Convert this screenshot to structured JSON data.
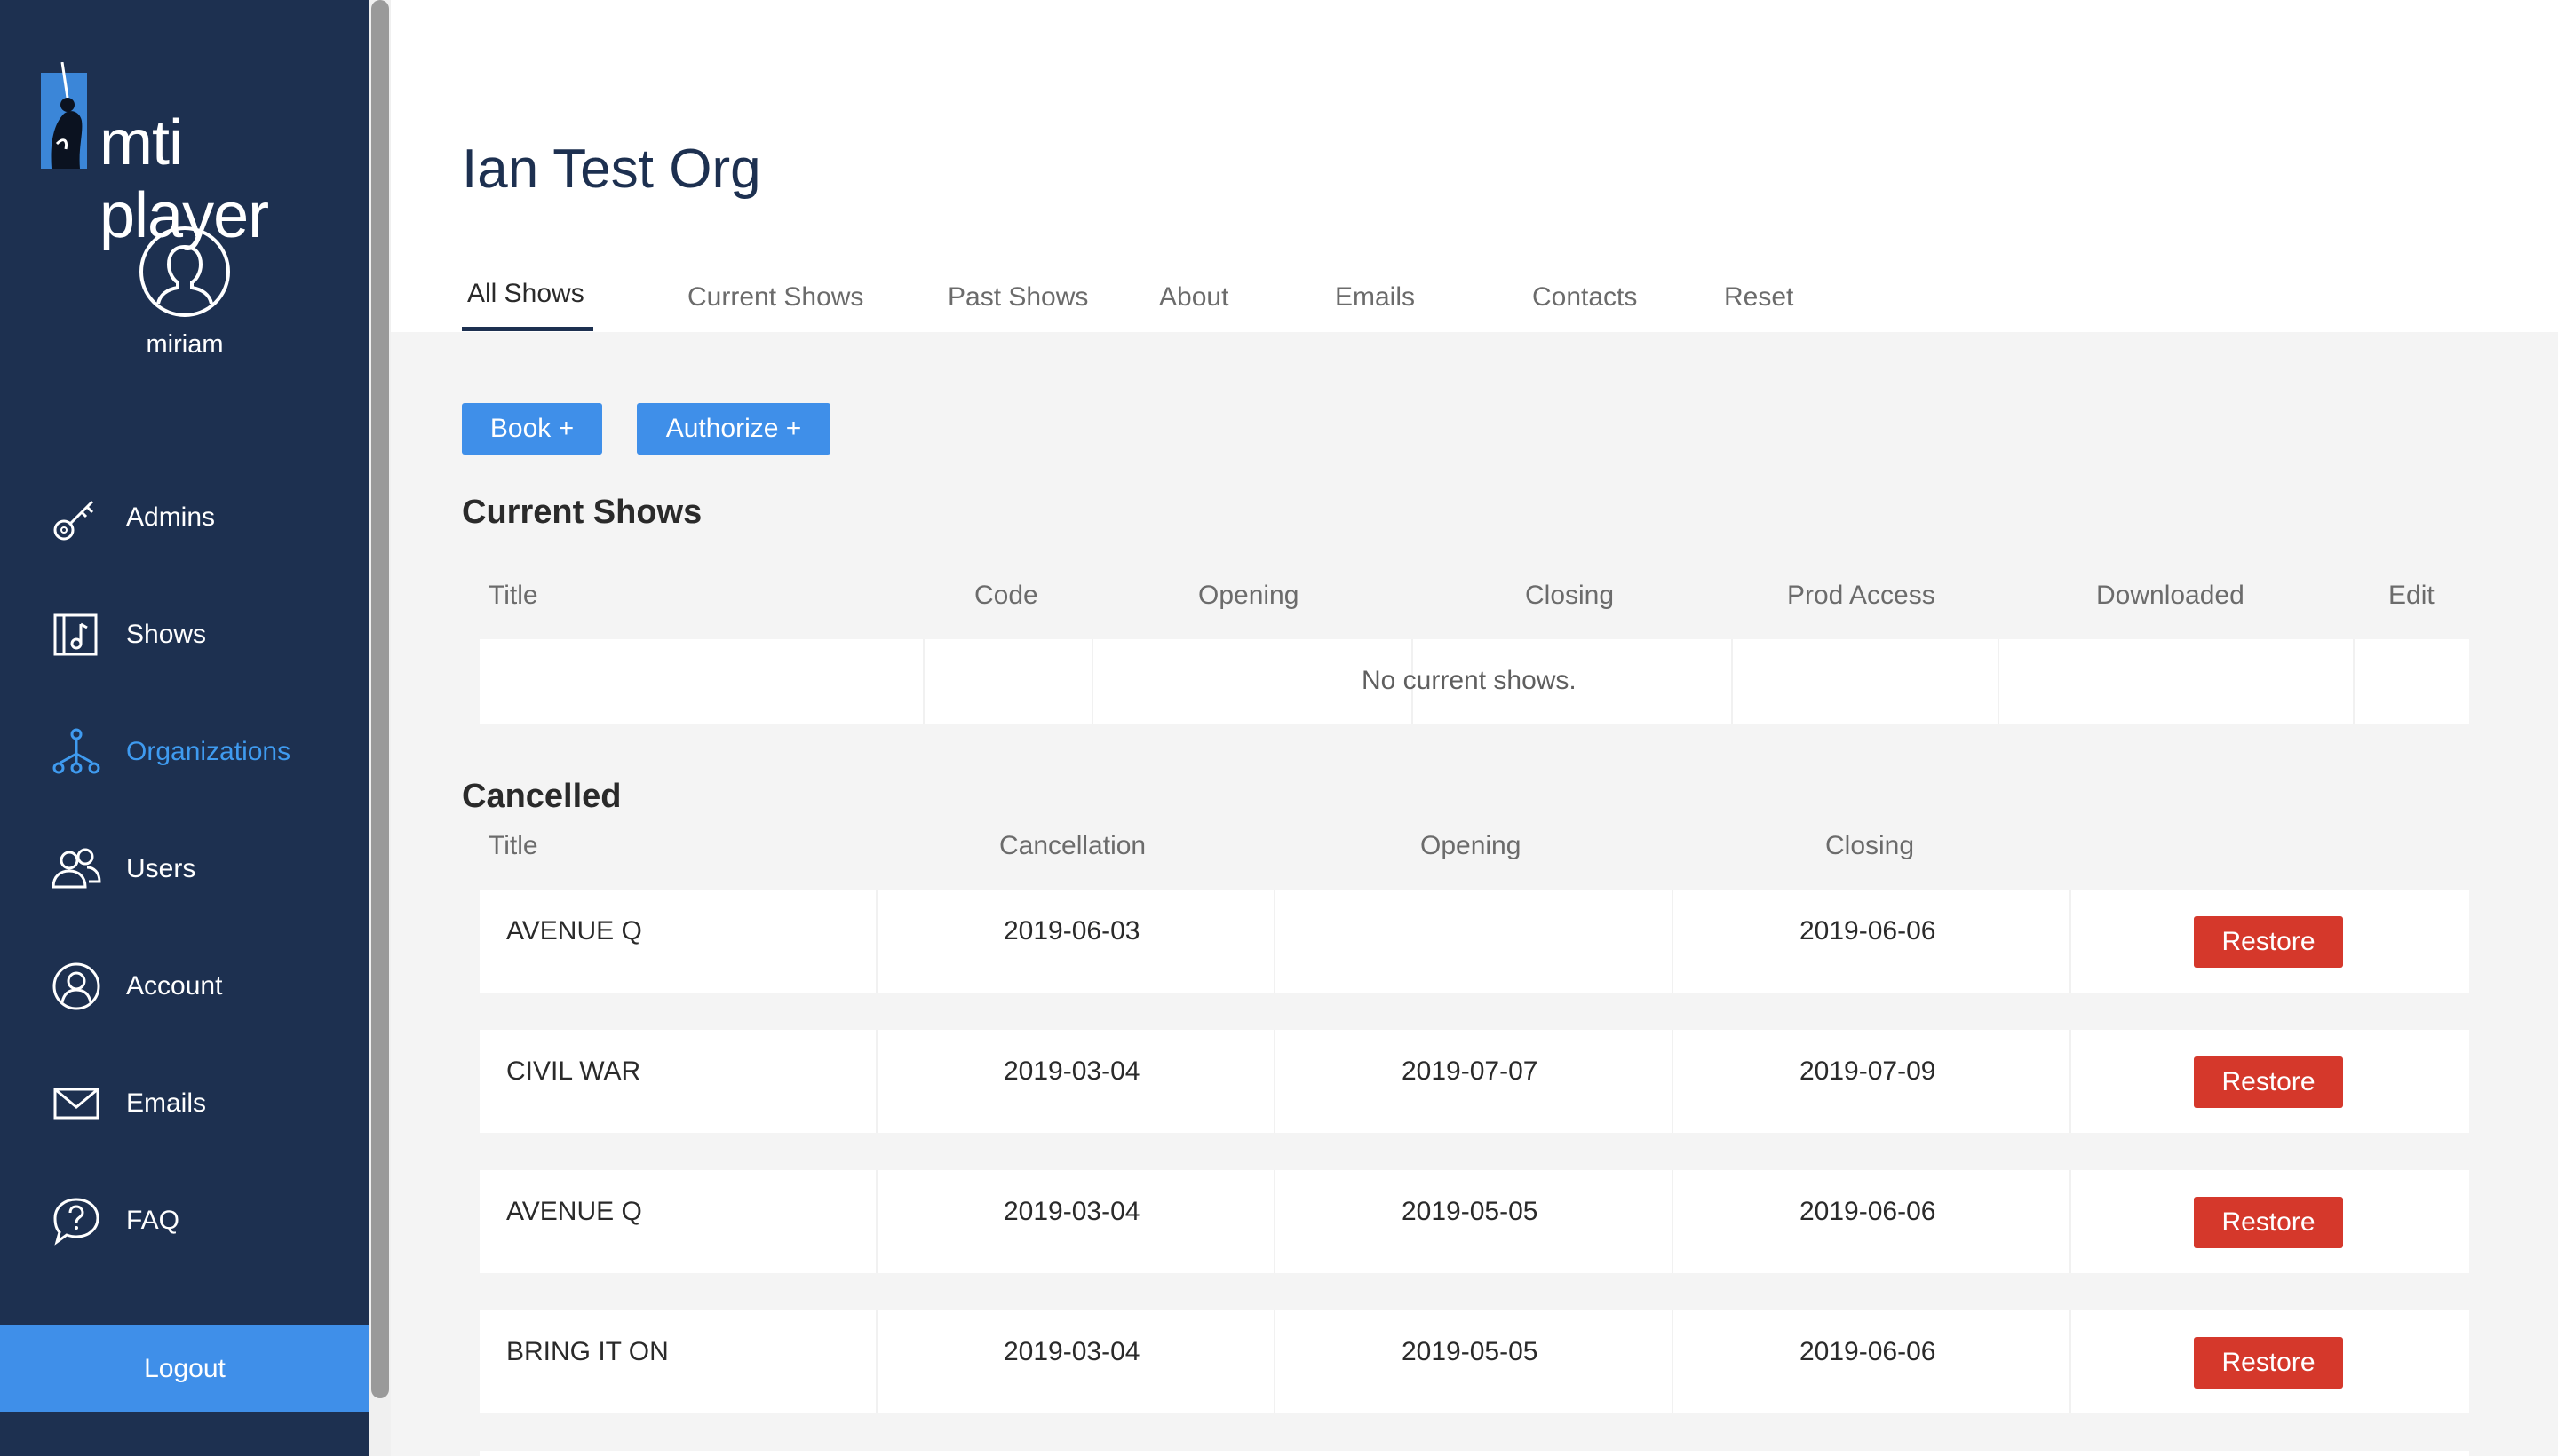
{
  "app": {
    "logo_text": "mti player",
    "username": "miriam",
    "logout_label": "Logout"
  },
  "sidebar": {
    "items": [
      {
        "label": "Admins",
        "icon": "key-icon"
      },
      {
        "label": "Shows",
        "icon": "music-note-icon"
      },
      {
        "label": "Organizations",
        "icon": "org-tree-icon",
        "active": true
      },
      {
        "label": "Users",
        "icon": "users-icon"
      },
      {
        "label": "Account",
        "icon": "account-icon"
      },
      {
        "label": "Emails",
        "icon": "envelope-icon"
      },
      {
        "label": "FAQ",
        "icon": "question-bubble-icon"
      }
    ]
  },
  "header": {
    "title": "Ian Test Org",
    "tabs": [
      {
        "label": "All Shows",
        "active": true
      },
      {
        "label": "Current Shows"
      },
      {
        "label": "Past Shows"
      },
      {
        "label": "About"
      },
      {
        "label": "Emails"
      },
      {
        "label": "Contacts"
      },
      {
        "label": "Reset"
      }
    ]
  },
  "actions": {
    "book_label": "Book +",
    "authorize_label": "Authorize +"
  },
  "current_shows": {
    "title": "Current Shows",
    "columns": [
      "Title",
      "Code",
      "Opening",
      "Closing",
      "Prod Access",
      "Downloaded",
      "Edit"
    ],
    "empty_message": "No current shows."
  },
  "cancelled": {
    "title": "Cancelled",
    "columns": [
      "Title",
      "Cancellation",
      "Opening",
      "Closing"
    ],
    "restore_label": "Restore",
    "rows": [
      {
        "title": "AVENUE Q",
        "cancellation": "2019-06-03",
        "opening": "",
        "closing": "2019-06-06"
      },
      {
        "title": "CIVIL WAR",
        "cancellation": "2019-03-04",
        "opening": "2019-07-07",
        "closing": "2019-07-09"
      },
      {
        "title": "AVENUE Q",
        "cancellation": "2019-03-04",
        "opening": "2019-05-05",
        "closing": "2019-06-06"
      },
      {
        "title": "BRING IT ON",
        "cancellation": "2019-03-04",
        "opening": "2019-05-05",
        "closing": "2019-06-06"
      }
    ]
  },
  "colors": {
    "sidebar_bg": "#1d3050",
    "accent_blue": "#3f8fe9",
    "active_nav": "#3f9bf0",
    "restore_red": "#d5382b"
  }
}
